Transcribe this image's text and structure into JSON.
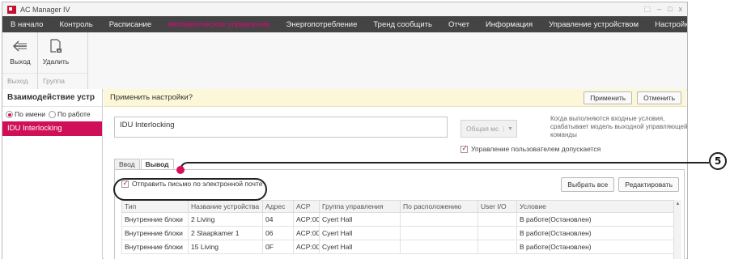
{
  "window": {
    "title": "AC Manager IV",
    "controls": [
      "⬚",
      "–",
      "□",
      "x"
    ]
  },
  "menu": [
    {
      "label": "В начало"
    },
    {
      "label": "Контроль"
    },
    {
      "label": "Расписание"
    },
    {
      "label": "Автоматическое управление",
      "active": true
    },
    {
      "label": "Энергопотребление"
    },
    {
      "label": "Тренд сообщить"
    },
    {
      "label": "Отчет"
    },
    {
      "label": "Информация"
    },
    {
      "label": "Управление устройством"
    },
    {
      "label": "Настройки"
    }
  ],
  "ribbon": {
    "exit_group": {
      "button": "Выход",
      "label": "Выход",
      "icon": "arrow-left-icon"
    },
    "group_group": {
      "button": "Удалить",
      "label": "Группа",
      "icon": "delete-doc-icon"
    }
  },
  "left": {
    "title": "Взаимодействие устр",
    "radio_by_name": "По имени",
    "radio_by_work": "По работе",
    "items": [
      {
        "label": "IDU Interlocking",
        "selected": true
      }
    ]
  },
  "main": {
    "apply_prompt": "Применить настройки?",
    "apply_button": "Применить",
    "cancel_button": "Отменить",
    "name_value": "IDU Interlocking",
    "scope_value": "Общая мс",
    "help_text": "Когда выполняются входные условия, срабатывает модель выходной управляющей команды",
    "user_control_label": "Управление пользователем допускается",
    "tabs": [
      {
        "label": "Ввод"
      },
      {
        "label": "Вывод",
        "active": true
      }
    ],
    "send_mail_label": "Отправить письмо по электронной почте",
    "select_all_button": "Выбрать все",
    "edit_button": "Редактировать"
  },
  "table": {
    "columns": [
      "Тип",
      "Название устройства",
      "Адрес",
      "ACP",
      "Группа управления",
      "По расположению",
      "User I/O",
      "Условие"
    ],
    "rows": [
      [
        "Внутренние блоки",
        "2 Living",
        "04",
        "ACP:00",
        "Cyert Hall",
        "",
        "",
        "В работе(Остановлен)"
      ],
      [
        "Внутренние блоки",
        "2 Slaapkamer 1",
        "06",
        "ACP:00",
        "Cyert Hall",
        "",
        "",
        "В работе(Остановлен)"
      ],
      [
        "Внутренние блоки",
        "15 Living",
        "0F",
        "ACP:00",
        "Cyert Hall",
        "",
        "",
        "В работе(Остановлен)"
      ]
    ]
  },
  "callout": {
    "number": "5"
  },
  "colors": {
    "accent": "#cf0f57",
    "menu_bg": "#444444",
    "menu_active": "#e3007b",
    "apply_bar": "#fbf7d8"
  }
}
